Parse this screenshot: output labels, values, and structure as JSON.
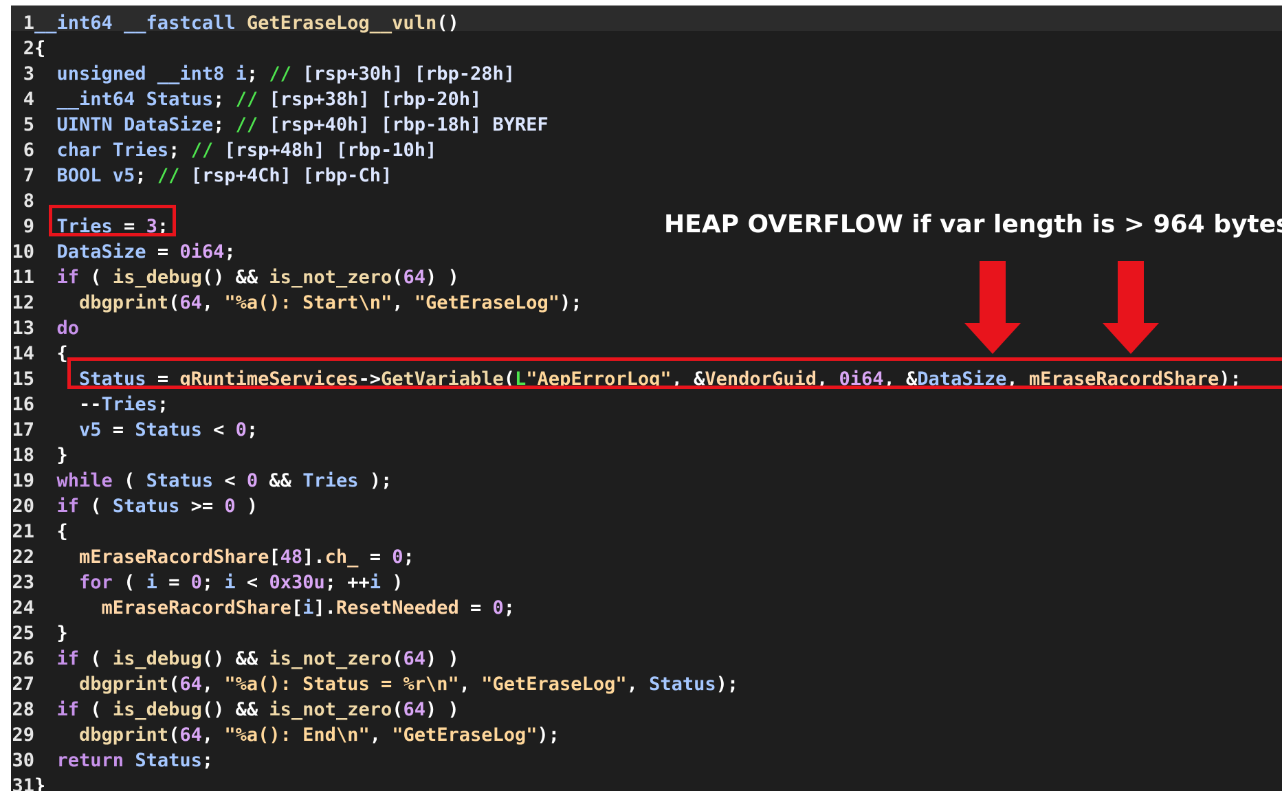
{
  "code_view": {
    "lines": [
      {
        "n": "1",
        "tokens": [
          {
            "c": "t-type",
            "t": "__int64 __fastcall "
          },
          {
            "c": "t-fn",
            "t": "GetEraseLog__vuln"
          },
          {
            "c": "t-punc",
            "t": "()"
          }
        ]
      },
      {
        "n": "2",
        "tokens": [
          {
            "c": "t-punc",
            "t": "{"
          }
        ]
      },
      {
        "n": "3",
        "tokens": [
          {
            "c": "t-type",
            "t": "  unsigned __int8 "
          },
          {
            "c": "t-id",
            "t": "i"
          },
          {
            "c": "t-punc",
            "t": "; "
          },
          {
            "c": "t-cmt",
            "t": "// "
          },
          {
            "c": "t-plain",
            "t": "[rsp+30h] [rbp-28h]"
          }
        ]
      },
      {
        "n": "4",
        "tokens": [
          {
            "c": "t-type",
            "t": "  __int64 "
          },
          {
            "c": "t-id",
            "t": "Status"
          },
          {
            "c": "t-punc",
            "t": "; "
          },
          {
            "c": "t-cmt",
            "t": "// "
          },
          {
            "c": "t-plain",
            "t": "[rsp+38h] [rbp-20h]"
          }
        ]
      },
      {
        "n": "5",
        "tokens": [
          {
            "c": "t-type",
            "t": "  UINTN "
          },
          {
            "c": "t-id",
            "t": "DataSize"
          },
          {
            "c": "t-punc",
            "t": "; "
          },
          {
            "c": "t-cmt",
            "t": "// "
          },
          {
            "c": "t-plain",
            "t": "[rsp+40h] [rbp-18h] BYREF"
          }
        ]
      },
      {
        "n": "6",
        "tokens": [
          {
            "c": "t-type",
            "t": "  char "
          },
          {
            "c": "t-id",
            "t": "Tries"
          },
          {
            "c": "t-punc",
            "t": "; "
          },
          {
            "c": "t-cmt",
            "t": "// "
          },
          {
            "c": "t-plain",
            "t": "[rsp+48h] [rbp-10h]"
          }
        ]
      },
      {
        "n": "7",
        "tokens": [
          {
            "c": "t-type",
            "t": "  BOOL "
          },
          {
            "c": "t-id",
            "t": "v5"
          },
          {
            "c": "t-punc",
            "t": "; "
          },
          {
            "c": "t-cmt",
            "t": "// "
          },
          {
            "c": "t-plain",
            "t": "[rsp+4Ch] [rbp-Ch]"
          }
        ]
      },
      {
        "n": "8",
        "tokens": []
      },
      {
        "n": "9",
        "tokens": [
          {
            "c": "t-id",
            "t": "  Tries"
          },
          {
            "c": "t-op",
            "t": " = "
          },
          {
            "c": "t-num",
            "t": "3"
          },
          {
            "c": "t-punc",
            "t": ";"
          }
        ]
      },
      {
        "n": "10",
        "tokens": [
          {
            "c": "t-id",
            "t": "  DataSize"
          },
          {
            "c": "t-op",
            "t": " = "
          },
          {
            "c": "t-num",
            "t": "0i64"
          },
          {
            "c": "t-punc",
            "t": ";"
          }
        ]
      },
      {
        "n": "11",
        "tokens": [
          {
            "c": "t-kw",
            "t": "  if"
          },
          {
            "c": "t-punc",
            "t": " ( "
          },
          {
            "c": "t-fn",
            "t": "is_debug"
          },
          {
            "c": "t-punc",
            "t": "() && "
          },
          {
            "c": "t-fn",
            "t": "is_not_zero"
          },
          {
            "c": "t-punc",
            "t": "("
          },
          {
            "c": "t-num",
            "t": "64"
          },
          {
            "c": "t-punc",
            "t": ") )"
          }
        ]
      },
      {
        "n": "12",
        "tokens": [
          {
            "c": "t-fn",
            "t": "    dbgprint"
          },
          {
            "c": "t-punc",
            "t": "("
          },
          {
            "c": "t-num",
            "t": "64"
          },
          {
            "c": "t-punc",
            "t": ", "
          },
          {
            "c": "t-str",
            "t": "\"%a(): Start\\n\""
          },
          {
            "c": "t-punc",
            "t": ", "
          },
          {
            "c": "t-str",
            "t": "\"GetEraseLog\""
          },
          {
            "c": "t-punc",
            "t": ");"
          }
        ]
      },
      {
        "n": "13",
        "tokens": [
          {
            "c": "t-kw",
            "t": "  do"
          }
        ]
      },
      {
        "n": "14",
        "tokens": [
          {
            "c": "t-punc",
            "t": "  {"
          }
        ]
      },
      {
        "n": "15",
        "tokens": [
          {
            "c": "t-id",
            "t": "    Status"
          },
          {
            "c": "t-op",
            "t": " = "
          },
          {
            "c": "t-glob",
            "t": "gRuntimeServices"
          },
          {
            "c": "t-punc",
            "t": "->"
          },
          {
            "c": "t-fn",
            "t": "GetVariable"
          },
          {
            "c": "t-punc",
            "t": "("
          },
          {
            "c": "t-cmt",
            "t": "L"
          },
          {
            "c": "t-str",
            "t": "\"AepErrorLog\""
          },
          {
            "c": "t-punc",
            "t": ", &"
          },
          {
            "c": "t-glob",
            "t": "VendorGuid"
          },
          {
            "c": "t-punc",
            "t": ", "
          },
          {
            "c": "t-num",
            "t": "0i64"
          },
          {
            "c": "t-punc",
            "t": ", &"
          },
          {
            "c": "t-id",
            "t": "DataSize"
          },
          {
            "c": "t-punc",
            "t": ", "
          },
          {
            "c": "t-glob",
            "t": "mEraseRacordShare"
          },
          {
            "c": "t-punc",
            "t": ");"
          }
        ]
      },
      {
        "n": "16",
        "tokens": [
          {
            "c": "t-punc",
            "t": "    --"
          },
          {
            "c": "t-id",
            "t": "Tries"
          },
          {
            "c": "t-punc",
            "t": ";"
          }
        ]
      },
      {
        "n": "17",
        "tokens": [
          {
            "c": "t-id",
            "t": "    v5"
          },
          {
            "c": "t-op",
            "t": " = "
          },
          {
            "c": "t-id",
            "t": "Status"
          },
          {
            "c": "t-op",
            "t": " < "
          },
          {
            "c": "t-num",
            "t": "0"
          },
          {
            "c": "t-punc",
            "t": ";"
          }
        ]
      },
      {
        "n": "18",
        "tokens": [
          {
            "c": "t-punc",
            "t": "  }"
          }
        ]
      },
      {
        "n": "19",
        "tokens": [
          {
            "c": "t-kw",
            "t": "  while"
          },
          {
            "c": "t-punc",
            "t": " ( "
          },
          {
            "c": "t-id",
            "t": "Status"
          },
          {
            "c": "t-op",
            "t": " < "
          },
          {
            "c": "t-num",
            "t": "0"
          },
          {
            "c": "t-op",
            "t": " && "
          },
          {
            "c": "t-id",
            "t": "Tries"
          },
          {
            "c": "t-punc",
            "t": " );"
          }
        ]
      },
      {
        "n": "20",
        "tokens": [
          {
            "c": "t-kw",
            "t": "  if"
          },
          {
            "c": "t-punc",
            "t": " ( "
          },
          {
            "c": "t-id",
            "t": "Status"
          },
          {
            "c": "t-op",
            "t": " >= "
          },
          {
            "c": "t-num",
            "t": "0"
          },
          {
            "c": "t-punc",
            "t": " )"
          }
        ]
      },
      {
        "n": "21",
        "tokens": [
          {
            "c": "t-punc",
            "t": "  {"
          }
        ]
      },
      {
        "n": "22",
        "tokens": [
          {
            "c": "t-glob",
            "t": "    mEraseRacordShare"
          },
          {
            "c": "t-punc",
            "t": "["
          },
          {
            "c": "t-num",
            "t": "48"
          },
          {
            "c": "t-punc",
            "t": "]."
          },
          {
            "c": "t-glob",
            "t": "ch_"
          },
          {
            "c": "t-op",
            "t": " = "
          },
          {
            "c": "t-num",
            "t": "0"
          },
          {
            "c": "t-punc",
            "t": ";"
          }
        ]
      },
      {
        "n": "23",
        "tokens": [
          {
            "c": "t-kw",
            "t": "    for"
          },
          {
            "c": "t-punc",
            "t": " ( "
          },
          {
            "c": "t-id",
            "t": "i"
          },
          {
            "c": "t-op",
            "t": " = "
          },
          {
            "c": "t-num",
            "t": "0"
          },
          {
            "c": "t-punc",
            "t": "; "
          },
          {
            "c": "t-id",
            "t": "i"
          },
          {
            "c": "t-op",
            "t": " < "
          },
          {
            "c": "t-num",
            "t": "0x30u"
          },
          {
            "c": "t-punc",
            "t": "; ++"
          },
          {
            "c": "t-id",
            "t": "i"
          },
          {
            "c": "t-punc",
            "t": " )"
          }
        ]
      },
      {
        "n": "24",
        "tokens": [
          {
            "c": "t-glob",
            "t": "      mEraseRacordShare"
          },
          {
            "c": "t-punc",
            "t": "["
          },
          {
            "c": "t-id",
            "t": "i"
          },
          {
            "c": "t-punc",
            "t": "]."
          },
          {
            "c": "t-glob",
            "t": "ResetNeeded"
          },
          {
            "c": "t-op",
            "t": " = "
          },
          {
            "c": "t-num",
            "t": "0"
          },
          {
            "c": "t-punc",
            "t": ";"
          }
        ]
      },
      {
        "n": "25",
        "tokens": [
          {
            "c": "t-punc",
            "t": "  }"
          }
        ]
      },
      {
        "n": "26",
        "tokens": [
          {
            "c": "t-kw",
            "t": "  if"
          },
          {
            "c": "t-punc",
            "t": " ( "
          },
          {
            "c": "t-fn",
            "t": "is_debug"
          },
          {
            "c": "t-punc",
            "t": "() && "
          },
          {
            "c": "t-fn",
            "t": "is_not_zero"
          },
          {
            "c": "t-punc",
            "t": "("
          },
          {
            "c": "t-num",
            "t": "64"
          },
          {
            "c": "t-punc",
            "t": ") )"
          }
        ]
      },
      {
        "n": "27",
        "tokens": [
          {
            "c": "t-fn",
            "t": "    dbgprint"
          },
          {
            "c": "t-punc",
            "t": "("
          },
          {
            "c": "t-num",
            "t": "64"
          },
          {
            "c": "t-punc",
            "t": ", "
          },
          {
            "c": "t-str",
            "t": "\"%a(): Status = %r\\n\""
          },
          {
            "c": "t-punc",
            "t": ", "
          },
          {
            "c": "t-str",
            "t": "\"GetEraseLog\""
          },
          {
            "c": "t-punc",
            "t": ", "
          },
          {
            "c": "t-id",
            "t": "Status"
          },
          {
            "c": "t-punc",
            "t": ");"
          }
        ]
      },
      {
        "n": "28",
        "tokens": [
          {
            "c": "t-kw",
            "t": "  if"
          },
          {
            "c": "t-punc",
            "t": " ( "
          },
          {
            "c": "t-fn",
            "t": "is_debug"
          },
          {
            "c": "t-punc",
            "t": "() && "
          },
          {
            "c": "t-fn",
            "t": "is_not_zero"
          },
          {
            "c": "t-punc",
            "t": "("
          },
          {
            "c": "t-num",
            "t": "64"
          },
          {
            "c": "t-punc",
            "t": ") )"
          }
        ]
      },
      {
        "n": "29",
        "tokens": [
          {
            "c": "t-fn",
            "t": "    dbgprint"
          },
          {
            "c": "t-punc",
            "t": "("
          },
          {
            "c": "t-num",
            "t": "64"
          },
          {
            "c": "t-punc",
            "t": ", "
          },
          {
            "c": "t-str",
            "t": "\"%a(): End\\n\""
          },
          {
            "c": "t-punc",
            "t": ", "
          },
          {
            "c": "t-str",
            "t": "\"GetEraseLog\""
          },
          {
            "c": "t-punc",
            "t": ");"
          }
        ]
      },
      {
        "n": "30",
        "tokens": [
          {
            "c": "t-kw",
            "t": "  return "
          },
          {
            "c": "t-id",
            "t": "Status"
          },
          {
            "c": "t-punc",
            "t": ";"
          }
        ]
      },
      {
        "n": "31",
        "tokens": [
          {
            "c": "t-punc",
            "t": "}"
          }
        ]
      }
    ]
  },
  "annotation": {
    "text": "HEAP OVERFLOW if var length is > 964 bytes",
    "highlight_color": "#e8141c",
    "arrow_icon": "down-arrow-icon"
  },
  "colors": {
    "background": "#1e1e1e",
    "highlight": "#e8141c"
  }
}
